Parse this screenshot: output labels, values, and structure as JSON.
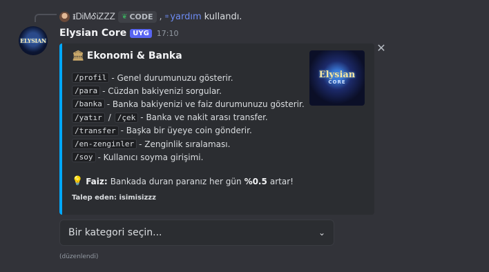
{
  "reply": {
    "username": "ᵻᎠᎥᎷᎴᎥᏃᏃᏃ",
    "badge": "CODE",
    "separator": ",",
    "command": "yardım",
    "suffix": "kullandı."
  },
  "message": {
    "author": "Elysian Core",
    "bot_tag": "UYG",
    "timestamp": "17:10",
    "avatar_text": "ELYSIAN",
    "edited_label": "(düzenlendi)"
  },
  "embed": {
    "accent_color": "#00a8fc",
    "title": "Ekonomi & Banka",
    "thumbnail_text_top": "Elysian",
    "thumbnail_text_bottom": "CORE",
    "commands": [
      {
        "code": "/profil",
        "desc": "- Genel durumunuzu gösterir."
      },
      {
        "code": "/para",
        "desc": "- Cüzdan bakiyenizi sorgular."
      },
      {
        "code": "/banka",
        "desc": "- Banka bakiyenizi ve faiz durumunuzu gösterir."
      },
      {
        "code": "/yatır",
        "sep": "/",
        "code2": "/çek",
        "desc": "- Banka ve nakit arası transfer."
      },
      {
        "code": "/transfer",
        "desc": "- Başka bir üyeye coin gönderir."
      },
      {
        "code": "/en-zenginler",
        "desc": "- Zenginlik sıralaması."
      },
      {
        "code": "/soy",
        "desc": "- Kullanıcı soyma girişimi."
      }
    ],
    "faiz_label": "Faiz:",
    "faiz_text_1": "Bankada duran paranız her gün",
    "faiz_rate": "%0.5",
    "faiz_text_2": "artar!",
    "footer": "Talep eden: isimisizzz"
  },
  "select": {
    "placeholder": "Bir kategori seçin..."
  }
}
